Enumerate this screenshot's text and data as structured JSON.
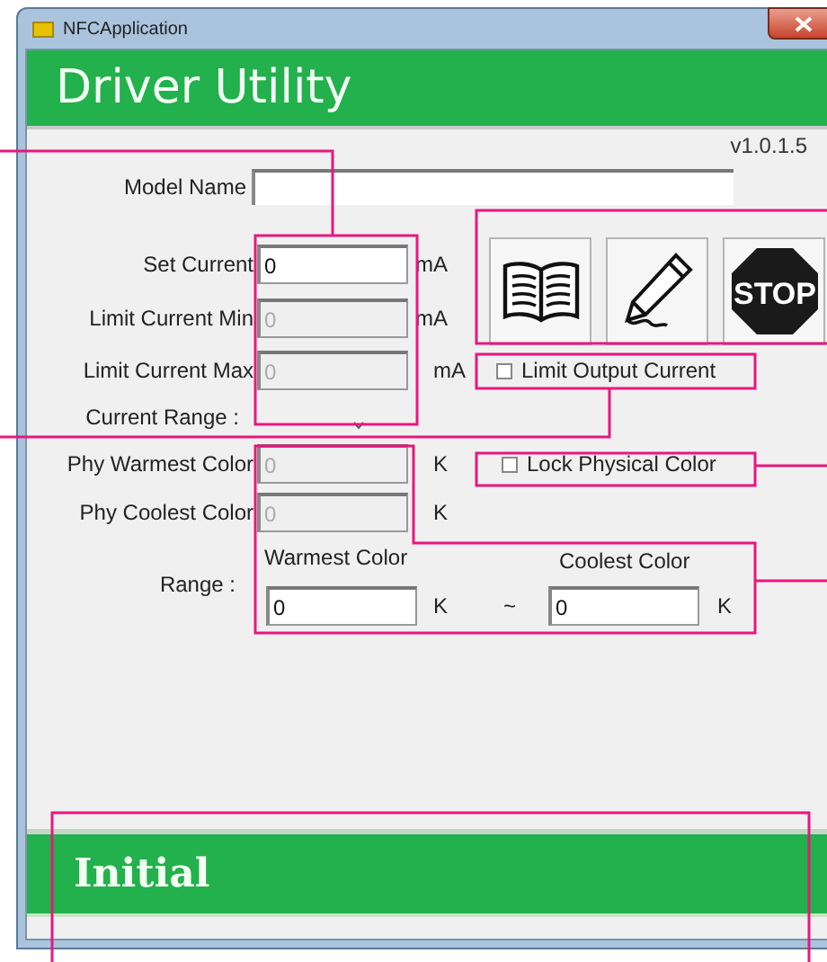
{
  "window": {
    "title": "NFCApplication"
  },
  "header": {
    "title": "Driver Utility"
  },
  "version": "v1.0.1.5",
  "model_name": {
    "label": "Model Name"
  },
  "current_fields": [
    {
      "label": "Set Current",
      "value": "0",
      "unit": "mA",
      "disabled": false
    },
    {
      "label": "Limit Current Min",
      "value": "0",
      "unit": "mA",
      "disabled": true
    },
    {
      "label": "Limit Current Max",
      "value": "0",
      "unit": "mA",
      "disabled": true
    }
  ],
  "current_range": {
    "label": "Current Range :"
  },
  "tool_buttons": [
    {
      "kind": "book"
    },
    {
      "kind": "pencil"
    },
    {
      "kind": "stop",
      "text": "STOP"
    }
  ],
  "limit_output_current": {
    "label": "Limit Output Current",
    "checked": false
  },
  "physical_fields": [
    {
      "label": "Phy Warmest Color",
      "value": "0",
      "unit": "K",
      "disabled": true
    },
    {
      "label": "Phy Coolest Color",
      "value": "0",
      "unit": "K",
      "disabled": true
    }
  ],
  "lock_physical_color": {
    "label": "Lock Physical Color",
    "checked": false
  },
  "range": {
    "label": "Range :",
    "separator": "~",
    "warmest": {
      "label": "Warmest Color",
      "value": "0",
      "unit": "K"
    },
    "coolest": {
      "label": "Coolest Color",
      "value": "0",
      "unit": "K"
    }
  },
  "status": {
    "text": "Initial"
  }
}
